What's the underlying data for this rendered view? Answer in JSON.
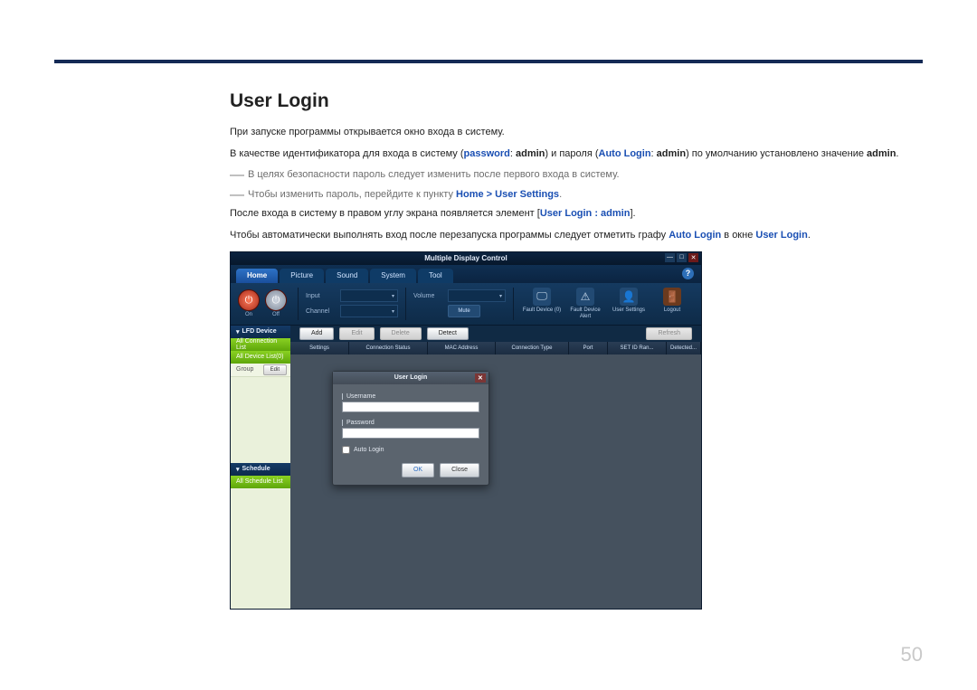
{
  "page": {
    "title": "User Login",
    "number": "50"
  },
  "paragraphs": {
    "p1": "При запуске программы открывается окно входа в систему.",
    "p2a": "В качестве идентификатора для входа в систему (",
    "p2_pw": "password",
    "p2b": ": ",
    "p2_admin1": "admin",
    "p2c": ") и пароля (",
    "p2_al": "Auto Login",
    "p2d": ": ",
    "p2_admin2": "admin",
    "p2e": ") по умолчанию установлено значение ",
    "p2_admin3": "admin",
    "p2f": ".",
    "n1": "В целях безопасности пароль следует изменить после первого входа в систему.",
    "n2a": "Чтобы изменить пароль, перейдите к пункту ",
    "n2_home": "Home",
    "n2_gt": " > ",
    "n2_us": "User Settings",
    "n2b": ".",
    "p3a": "После входа в систему в правом углу экрана появляется элемент [",
    "p3_ul": "User Login : admin",
    "p3b": "].",
    "p4a": "Чтобы автоматически выполнять вход после перезапуска программы следует отметить графу ",
    "p4_al": "Auto Login",
    "p4b": " в окне ",
    "p4_ul": "User Login",
    "p4c": "."
  },
  "app": {
    "title": "Multiple Display Control",
    "tabs": [
      "Home",
      "Picture",
      "Sound",
      "System",
      "Tool"
    ],
    "help": "?",
    "ribbon": {
      "on": "On",
      "off": "Off",
      "input": "Input",
      "channel": "Channel",
      "volume": "Volume",
      "mute": "Mute"
    },
    "icons": {
      "fault": "Fault Device (0)",
      "alert": "Fault Device Alert",
      "user": "User Settings",
      "logout": "Logout"
    },
    "sidebar": {
      "hdr1": "LFD Device",
      "row1": "All Connection List",
      "row2": "All Device List(0)",
      "row3": "Group",
      "edit": "Edit",
      "hdr2": "Schedule",
      "row4": "All Schedule List"
    },
    "buttons": {
      "add": "Add",
      "edit": "Edit",
      "delete": "Delete",
      "detect": "Detect",
      "refresh": "Refresh"
    },
    "cols": [
      "Settings",
      "Connection Status",
      "MAC Address",
      "Connection Type",
      "Port",
      "SET ID Ran...",
      "Detected..."
    ],
    "dialog": {
      "title": "User Login",
      "username": "Username",
      "password": "Password",
      "auto": "Auto Login",
      "ok": "OK",
      "close": "Close"
    }
  }
}
